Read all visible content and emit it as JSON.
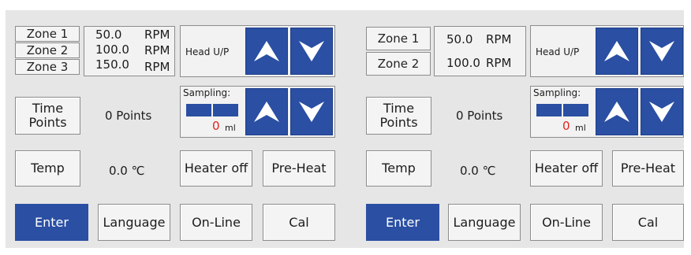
{
  "left": {
    "zones": [
      {
        "label": "Zone 1",
        "value": "50.0",
        "unit": "RPM"
      },
      {
        "label": "Zone 2",
        "value": "100.0",
        "unit": "RPM"
      },
      {
        "label": "Zone 3",
        "value": "150.0",
        "unit": "RPM"
      }
    ],
    "head_label": "Head U/P",
    "time_points_button": "Time Points",
    "points_text": "0  Points",
    "sampling_label": "Sampling:",
    "sampling_value": "0",
    "sampling_unit": "ml",
    "temp_button": "Temp",
    "temp_value": "0.0 ℃",
    "heater_button": "Heater off",
    "preheat_button": "Pre-Heat",
    "enter_button": "Enter",
    "language_button": "Language",
    "online_button": "On-Line",
    "cal_button": "Cal"
  },
  "right": {
    "zones": [
      {
        "label": "Zone 1",
        "value": "50.0",
        "unit": "RPM"
      },
      {
        "label": "Zone 2",
        "value": "100.0",
        "unit": "RPM"
      }
    ],
    "head_label": "Head U/P",
    "time_points_button": "Time Points",
    "points_text": "0  Points",
    "sampling_label": "Sampling:",
    "sampling_value": "0",
    "sampling_unit": "ml",
    "temp_button": "Temp",
    "temp_value": "0.0 ℃",
    "heater_button": "Heater off",
    "preheat_button": "Pre-Heat",
    "enter_button": "Enter",
    "language_button": "Language",
    "online_button": "On-Line",
    "cal_button": "Cal"
  },
  "icons": {
    "up": "up-arrow-icon",
    "down": "down-arrow-icon"
  },
  "colors": {
    "accent": "#2a4fa3",
    "sample_value": "#e0251f",
    "background": "#e6e6e6"
  }
}
